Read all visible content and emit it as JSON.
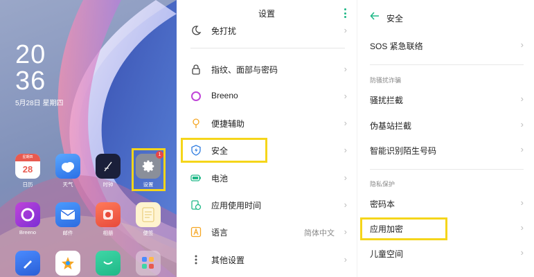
{
  "home": {
    "time_hour": "20",
    "time_minute": "36",
    "date": "5月28日 星期四",
    "calendar_weekday": "星期四",
    "calendar_day": "28",
    "settings_badge": "1",
    "apps": [
      {
        "label": "日历"
      },
      {
        "label": "天气"
      },
      {
        "label": "时钟"
      },
      {
        "label": "设置"
      },
      {
        "label": "Breeno"
      },
      {
        "label": "邮件"
      },
      {
        "label": "相册"
      },
      {
        "label": "便签"
      }
    ]
  },
  "settings": {
    "title": "设置",
    "items": [
      {
        "label": "免打扰",
        "icon": "moon-icon"
      },
      {
        "label": "指纹、面部与密码",
        "icon": "lock-icon"
      },
      {
        "label": "Breeno",
        "icon": "breeno-icon"
      },
      {
        "label": "便捷辅助",
        "icon": "hand-icon"
      },
      {
        "label": "安全",
        "icon": "shield-icon"
      },
      {
        "label": "电池",
        "icon": "battery-icon"
      },
      {
        "label": "应用使用时间",
        "icon": "app-timer-icon"
      },
      {
        "label": "语言",
        "icon": "language-icon",
        "value": "简体中文"
      },
      {
        "label": "其他设置",
        "icon": "more-settings-icon"
      }
    ]
  },
  "security": {
    "title": "安全",
    "items": [
      {
        "label": "SOS 紧急联络"
      },
      {
        "label": "骚扰拦截"
      },
      {
        "label": "伪基站拦截"
      },
      {
        "label": "智能识别陌生号码"
      },
      {
        "label": "密码本"
      },
      {
        "label": "应用加密"
      },
      {
        "label": "儿童空间"
      }
    ],
    "section_harassment": "防骚扰诈骗",
    "section_privacy": "隐私保护"
  },
  "colors": {
    "accent": "#1fb887",
    "highlight": "#f5d51a",
    "badge": "#e84646"
  }
}
